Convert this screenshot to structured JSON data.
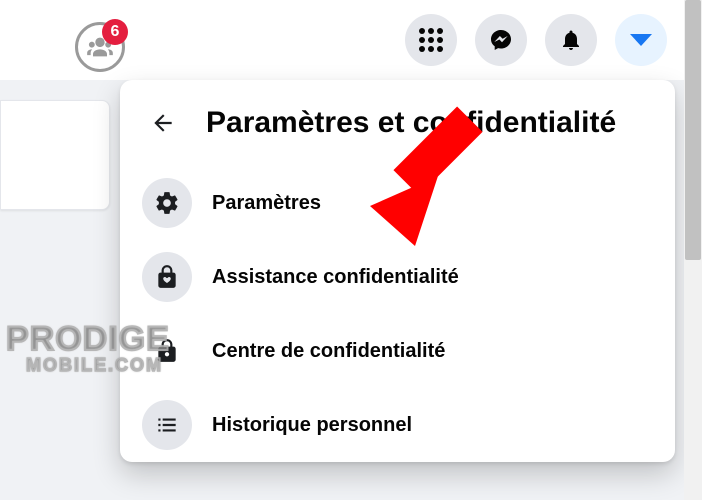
{
  "badge_count": "6",
  "dropdown": {
    "title": "Paramètres et confidentialité",
    "items": [
      {
        "label": "Paramètres"
      },
      {
        "label": "Assistance confidentialité"
      },
      {
        "label": "Centre de confidentialité"
      },
      {
        "label": "Historique personnel"
      }
    ]
  },
  "watermark": {
    "line1": "PRODIGE",
    "line2": "MOBILE.COM"
  }
}
